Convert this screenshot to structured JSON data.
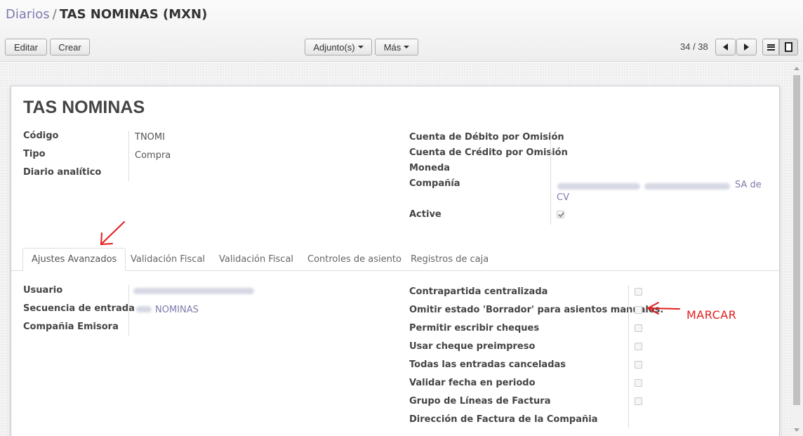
{
  "breadcrumb": {
    "parent": "Diarios",
    "separator": "/",
    "current": "TAS NOMINAS (MXN)"
  },
  "toolbar": {
    "edit_label": "Editar",
    "create_label": "Crear",
    "attach_label": "Adjunto(s)",
    "more_label": "Más"
  },
  "pager": {
    "value": "34 / 38"
  },
  "view_switcher": [
    "list-icon",
    "form-icon"
  ],
  "record": {
    "name": "TAS NOMINAS",
    "left_fields": [
      {
        "label": "Código",
        "value": "TNOMI"
      },
      {
        "label": "Tipo",
        "value": "Compra"
      },
      {
        "label": "Diario analítico",
        "value": ""
      }
    ],
    "right_fields": {
      "debit_label": "Cuenta de Débito por Omisión",
      "credit_label": "Cuenta de Crédito por Omisión",
      "currency_label": "Moneda",
      "company_label": "Compañía",
      "company_value_suffix": "SA de",
      "company_value_line2": "CV",
      "active_label": "Active",
      "active_checked": true
    }
  },
  "tabs": [
    {
      "label": "Ajustes Avanzados",
      "active": true
    },
    {
      "label": "Validación Fiscal",
      "active": false
    },
    {
      "label": "Validación Fiscal",
      "active": false
    },
    {
      "label": "Controles de asiento",
      "active": false
    },
    {
      "label": "Registros de caja",
      "active": false
    }
  ],
  "advanced": {
    "left": [
      {
        "label": "Usuario"
      },
      {
        "label": "Secuencia de entrada",
        "value": "NOMINAS"
      },
      {
        "label": "Compañia Emisora"
      }
    ],
    "right": [
      {
        "label": "Contrapartida centralizada",
        "checked": false
      },
      {
        "label": "Omitir estado 'Borrador' para asientos manuales.",
        "checked": false
      },
      {
        "label": "Permitir escribir cheques",
        "checked": false
      },
      {
        "label": "Usar cheque preimpreso",
        "checked": false
      },
      {
        "label": "Todas las entradas canceladas",
        "checked": false
      },
      {
        "label": "Validar fecha en periodo",
        "checked": false
      },
      {
        "label": "Grupo de Líneas de Factura",
        "checked": false
      },
      {
        "label": "Dirección de Factura de la Compañia"
      }
    ]
  },
  "annotation": {
    "text": "MARCAR"
  },
  "colors": {
    "link": "#7c7bad",
    "annotation": "#e41c1c"
  }
}
